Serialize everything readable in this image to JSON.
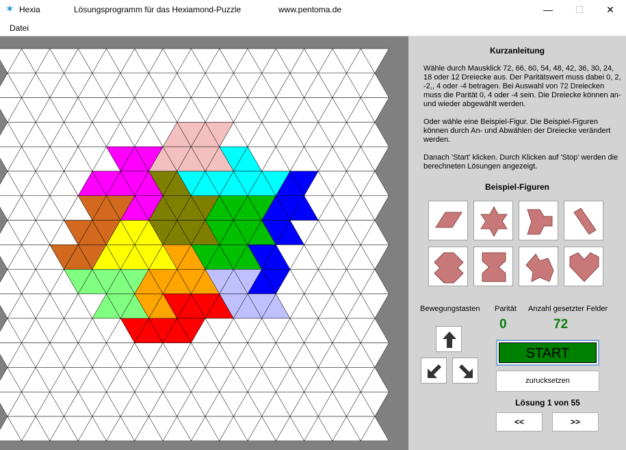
{
  "window": {
    "app_name": "Hexia",
    "subtitle": "Lösungsprogramm für das Hexiamond-Puzzle",
    "website": "www.pentoma.de",
    "minimize_glyph": "—",
    "maximize_glyph": "☐",
    "close_glyph": "✕",
    "app_icon": "hexagram-icon"
  },
  "menu": {
    "items": [
      "Datei"
    ]
  },
  "board": {
    "rows": 16,
    "triangles_per_row": 27,
    "background": "#808080",
    "cell_fill": "#ffffff",
    "line_color": "#000000",
    "pieces": [
      {
        "name": "pink",
        "color": "#f4bfbf"
      },
      {
        "name": "magenta",
        "color": "#ff00ff"
      },
      {
        "name": "olive",
        "color": "#808000"
      },
      {
        "name": "cyan",
        "color": "#00ffff"
      },
      {
        "name": "blue",
        "color": "#0000ff"
      },
      {
        "name": "orange-brown",
        "color": "#d2691e"
      },
      {
        "name": "yellow",
        "color": "#ffff00"
      },
      {
        "name": "green",
        "color": "#00c000"
      },
      {
        "name": "light-green",
        "color": "#80ff80"
      },
      {
        "name": "orange",
        "color": "#ffa500"
      },
      {
        "name": "lavender",
        "color": "#c0c0ff"
      },
      {
        "name": "red",
        "color": "#ff0000"
      }
    ]
  },
  "panel": {
    "heading": "Kurzanleitung",
    "instructions": [
      "Wähle durch Mausklick 72, 66, 60, 54, 48, 42, 36, 30, 24, 18 oder 12  Dreiecke aus. Der Paritätswert muss dabei  0, 2, -2,, 4 oder -4 betragen. Bei Auswahl von 72 Dreiecken muss die Parität 0, 4 oder -4 sein.  Die Dreiecke können an- und wieder abgewählt werden.",
      "Oder wähle eine Beispiel-Figur. Die Beispiel-Figuren können durch An- und Abwählen der Dreiecke verändert werden.",
      "Danach 'Start' klicken. Durch Klicken auf 'Stop' werden die berechneten Lösungen angezeigt."
    ],
    "examples_heading": "Beispiel-Figuren",
    "example_figures": [
      "parallelogram",
      "hexagram",
      "triangle-blob",
      "diagonal-bar",
      "arrow-hex",
      "hourglass",
      "jagged-shape",
      "heart"
    ],
    "figure_color": "#c87878",
    "movement_label": "Bewegungstasten",
    "parity_label": "Parität",
    "count_label": "Anzahl gesetzter Felder",
    "parity_value": "0",
    "count_value": "72",
    "arrow_buttons": [
      "up",
      "down-left",
      "down-right"
    ],
    "start_label": "START",
    "start_color": "#008000",
    "reset_label": "zurucksetzen",
    "solution_text": "Lösung 1 von 55",
    "prev_label": "<<",
    "next_label": ">>"
  }
}
